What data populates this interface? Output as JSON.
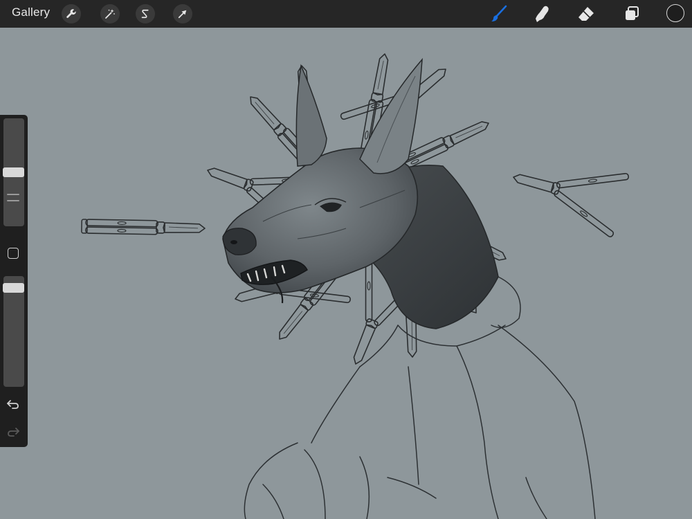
{
  "toolbar": {
    "gallery_label": "Gallery",
    "left_tools": [
      {
        "name": "actions",
        "icon": "wrench-icon"
      },
      {
        "name": "adjustments",
        "icon": "magic-wand-icon"
      },
      {
        "name": "selection",
        "icon": "selection-s-icon"
      },
      {
        "name": "transform",
        "icon": "arrow-cursor-icon"
      }
    ],
    "right_tools": [
      {
        "name": "brush",
        "icon": "brush-icon",
        "active": true
      },
      {
        "name": "smudge",
        "icon": "smudge-finger-icon"
      },
      {
        "name": "eraser",
        "icon": "eraser-icon"
      },
      {
        "name": "layers",
        "icon": "layers-icon"
      },
      {
        "name": "color",
        "icon": "color-swatch"
      }
    ],
    "active_color": "#1a6fe0",
    "current_color": "#1e1e1e"
  },
  "sidebar": {
    "brush_size_level": 0.5,
    "opacity_level": 0.93,
    "modify_button_icon": "square-icon",
    "undo_icon": "undo-icon",
    "redo_icon": "redo-icon"
  },
  "canvas": {
    "background": "#8e979b",
    "artwork": "sketch-doberman-with-butterfly-knives"
  }
}
